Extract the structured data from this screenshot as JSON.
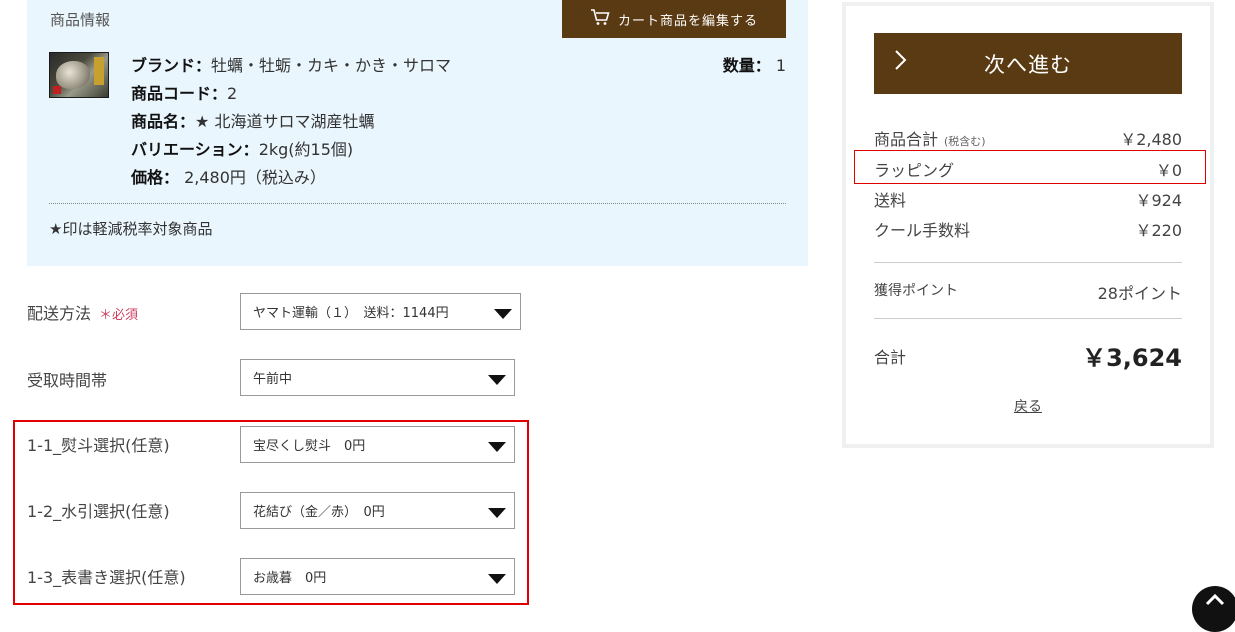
{
  "product": {
    "section_title": "商品情報",
    "edit_cart_label": "カート商品を編集する",
    "brand_label": "ブランド：",
    "brand_value": "牡蠣・牡蛎・カキ・かき・サロマ",
    "code_label": "商品コード：",
    "code_value": "2",
    "name_label": "商品名：",
    "name_value": "★ 北海道サロマ湖産牡蠣",
    "variation_label": "バリエーション：",
    "variation_value": "2kg(約15個)",
    "price_label": "価格：",
    "price_value": " 2,480円（税込み）",
    "qty_label": "数量：",
    "qty_value": " 1",
    "tax_note": "★印は軽減税率対象商品"
  },
  "form": {
    "shipping_label": "配送方法",
    "required_label": "＊必須",
    "shipping_value": "ヤマト運輸（１）　送料：1144円",
    "time_label": "受取時間帯",
    "time_value": "午前中",
    "noshi_label": "1-1_熨斗選択(任意)",
    "noshi_value": "宝尽くし熨斗　0円",
    "mizuhiki_label": "1-2_水引選択(任意)",
    "mizuhiki_value": "花結び（金／赤）　0円",
    "omotegaki_label": "1-3_表書き選択(任意)",
    "omotegaki_value": "お歳暮　0円"
  },
  "summary": {
    "next_label": "次へ進む",
    "next_icon": "chevron-right-icon",
    "subtotal_label": "商品合計",
    "subtotal_note": "(税含む)",
    "subtotal_value": "￥2,480",
    "wrapping_label": "ラッピング",
    "wrapping_value": "￥0",
    "shipping_label": "送料",
    "shipping_value": "￥924",
    "cool_label": "クール手数料",
    "cool_value": "￥220",
    "points_label": "獲得ポイント",
    "points_value": "28ポイント",
    "total_label": "合計",
    "total_value": "￥3,624",
    "back_label": "戻る"
  },
  "colors": {
    "accent": "#5a3a12",
    "panel_bg": "#eaf6fd",
    "highlight": "#e00000"
  }
}
